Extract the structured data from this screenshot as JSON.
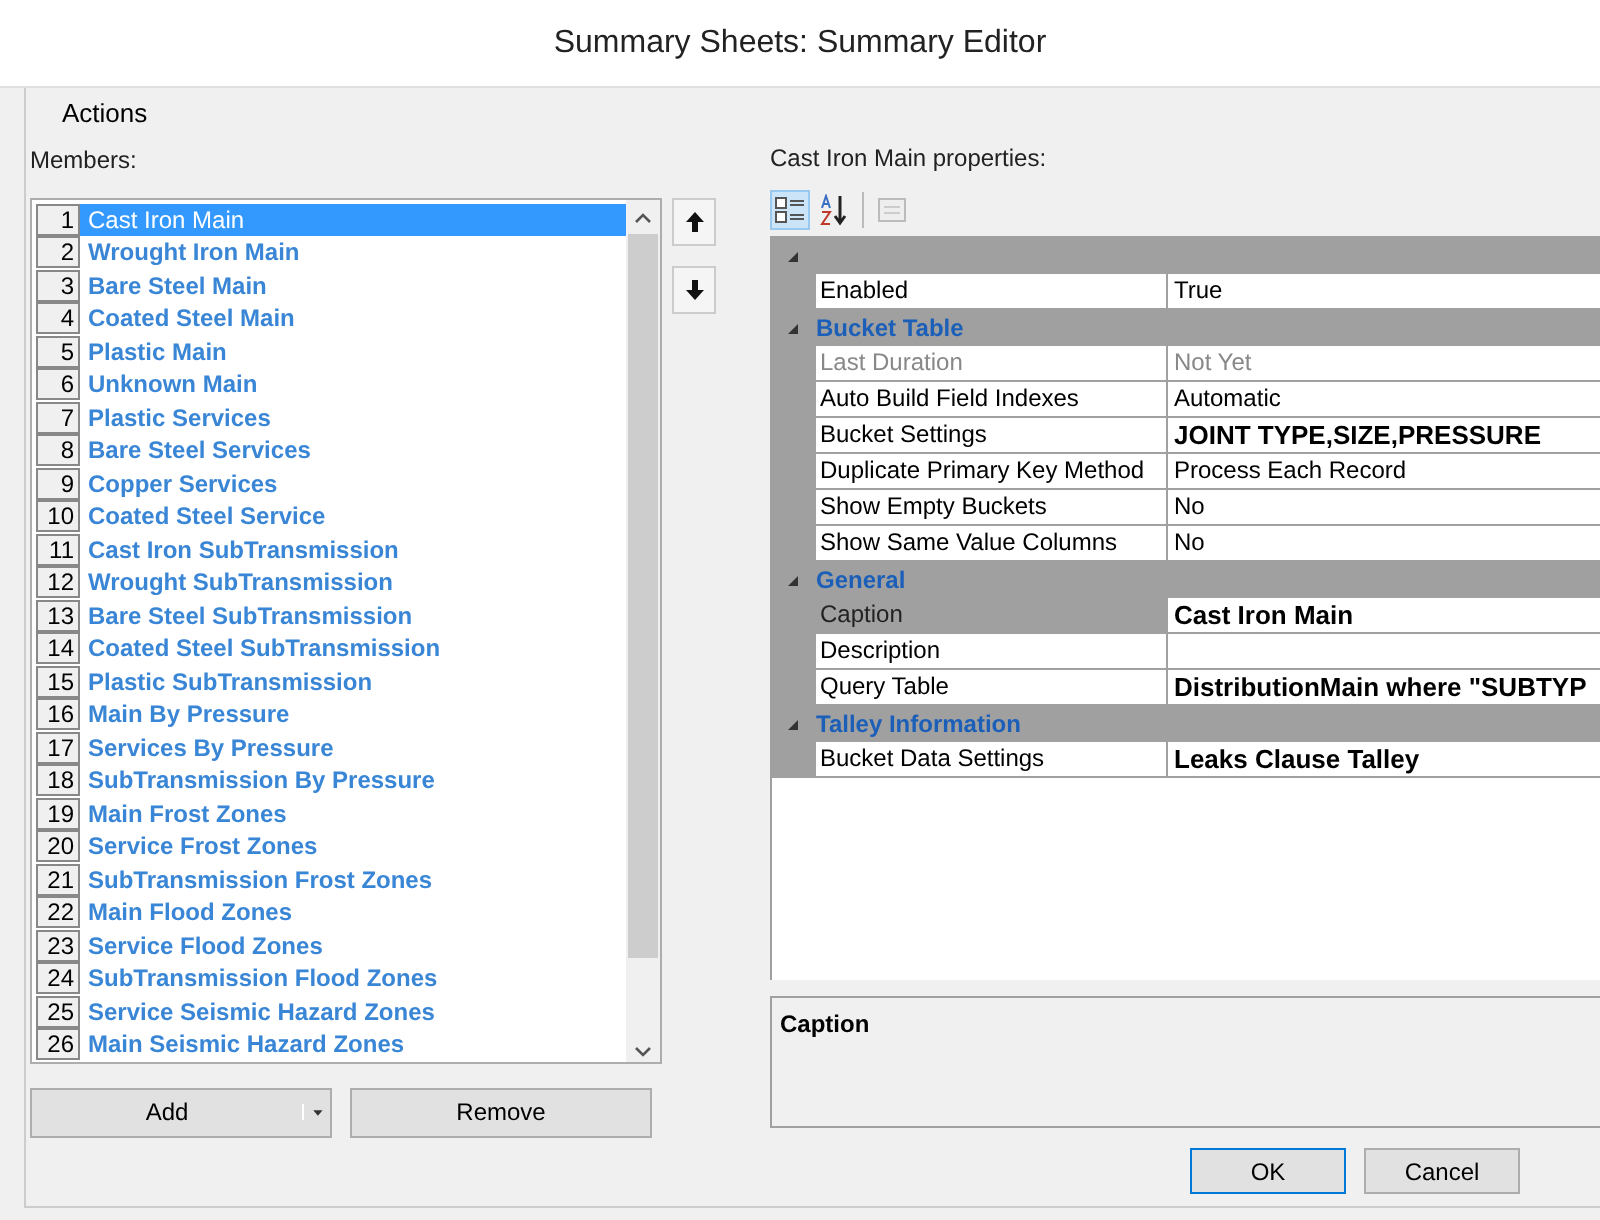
{
  "window": {
    "title": "Summary Sheets: Summary Editor"
  },
  "menu": [
    "Actions"
  ],
  "members": {
    "label": "Members:",
    "items": [
      {
        "number": "1",
        "name": "Cast Iron Main",
        "selected": true
      },
      {
        "number": "2",
        "name": "Wrought Iron Main",
        "selected": false
      },
      {
        "number": "3",
        "name": "Bare Steel Main",
        "selected": false
      },
      {
        "number": "4",
        "name": "Coated Steel Main",
        "selected": false
      },
      {
        "number": "5",
        "name": "Plastic Main",
        "selected": false
      },
      {
        "number": "6",
        "name": "Unknown Main",
        "selected": false
      },
      {
        "number": "7",
        "name": "Plastic Services",
        "selected": false
      },
      {
        "number": "8",
        "name": "Bare Steel Services",
        "selected": false
      },
      {
        "number": "9",
        "name": "Copper Services",
        "selected": false
      },
      {
        "number": "10",
        "name": "Coated Steel Service",
        "selected": false
      },
      {
        "number": "11",
        "name": "Cast Iron SubTransmission",
        "selected": false
      },
      {
        "number": "12",
        "name": "Wrought SubTransmission",
        "selected": false
      },
      {
        "number": "13",
        "name": "Bare Steel SubTransmission",
        "selected": false
      },
      {
        "number": "14",
        "name": "Coated Steel SubTransmission",
        "selected": false
      },
      {
        "number": "15",
        "name": "Plastic SubTransmission",
        "selected": false
      },
      {
        "number": "16",
        "name": "Main By Pressure",
        "selected": false
      },
      {
        "number": "17",
        "name": "Services By Pressure",
        "selected": false
      },
      {
        "number": "18",
        "name": "SubTransmission By Pressure",
        "selected": false
      },
      {
        "number": "19",
        "name": "Main Frost Zones",
        "selected": false
      },
      {
        "number": "20",
        "name": "Service Frost Zones",
        "selected": false
      },
      {
        "number": "21",
        "name": "SubTransmission Frost Zones",
        "selected": false
      },
      {
        "number": "22",
        "name": "Main Flood Zones",
        "selected": false
      },
      {
        "number": "23",
        "name": "Service Flood Zones",
        "selected": false
      },
      {
        "number": "24",
        "name": "SubTransmission Flood Zones",
        "selected": false
      },
      {
        "number": "25",
        "name": "Service Seismic Hazard Zones",
        "selected": false
      },
      {
        "number": "26",
        "name": "Main Seismic Hazard Zones",
        "selected": false
      }
    ],
    "add_button": "Add",
    "remove_button": "Remove"
  },
  "properties": {
    "label": "Cast Iron Main properties:",
    "toolbar": [
      {
        "kind": "categorized",
        "selected": true
      },
      {
        "kind": "alphabetical",
        "selected": false
      },
      {
        "kind": "pages",
        "selected": false
      }
    ],
    "categories": [
      {
        "expanded": true,
        "rows": [
          {
            "name": "Enabled",
            "value": "True",
            "bold": false,
            "disabled": false,
            "selected": false
          }
        ]
      },
      {
        "name": "Bucket Table",
        "expanded": true,
        "rows": [
          {
            "name": "Last Duration",
            "value": "Not Yet",
            "bold": false,
            "disabled": true,
            "selected": false
          },
          {
            "name": "Auto Build Field Indexes",
            "value": "Automatic",
            "bold": false,
            "disabled": false,
            "selected": false
          },
          {
            "name": "Bucket Settings",
            "value": "JOINT TYPE,SIZE,PRESSURE",
            "bold": true,
            "disabled": false,
            "selected": false
          },
          {
            "name": "Duplicate Primary Key Method",
            "value": "Process Each Record",
            "bold": false,
            "disabled": false,
            "selected": false
          },
          {
            "name": "Show Empty Buckets",
            "value": "No",
            "bold": false,
            "disabled": false,
            "selected": false
          },
          {
            "name": "Show Same Value Columns",
            "value": "No",
            "bold": false,
            "disabled": false,
            "selected": false
          }
        ]
      },
      {
        "name": "General",
        "expanded": true,
        "rows": [
          {
            "name": "Caption",
            "value": "Cast Iron Main",
            "bold": true,
            "disabled": false,
            "selected": true
          },
          {
            "name": "Description",
            "bold": false,
            "disabled": false,
            "selected": false
          },
          {
            "name": "Query Table",
            "value": "DistributionMain where \"SUBTYP",
            "bold": true,
            "disabled": false,
            "selected": false
          }
        ]
      },
      {
        "name": "Talley Information",
        "expanded": true,
        "rows": [
          {
            "name": "Bucket Data Settings",
            "value": "Leaks Clause Talley",
            "bold": true,
            "disabled": false,
            "selected": false
          }
        ]
      }
    ],
    "description_title": "Caption"
  },
  "buttons": [
    "OK",
    "Cancel"
  ]
}
